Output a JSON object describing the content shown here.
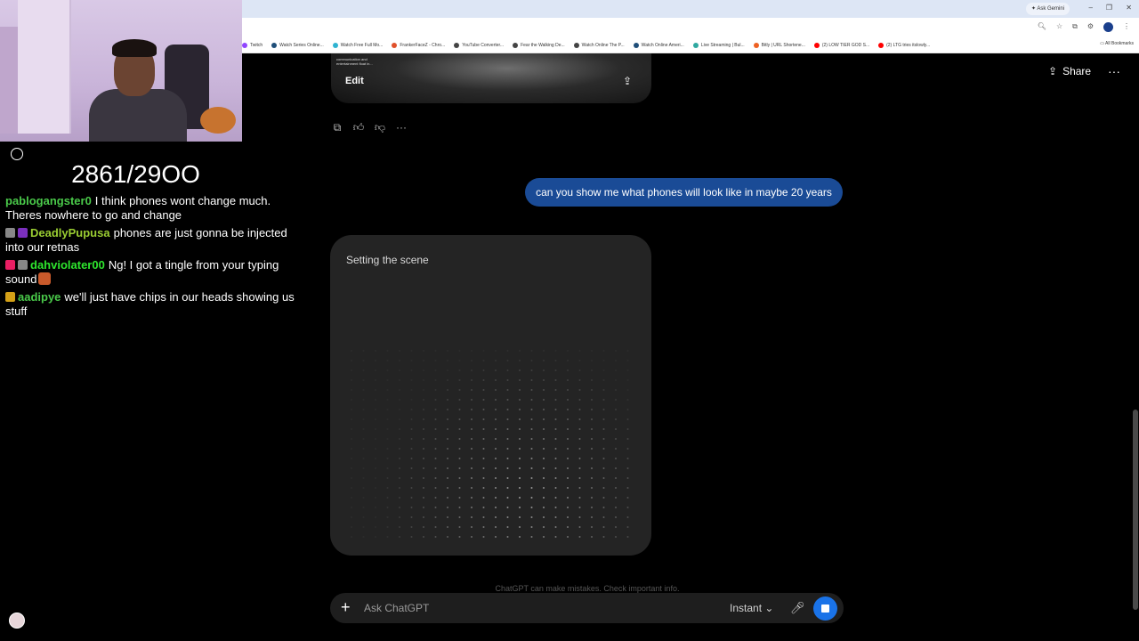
{
  "browser": {
    "ask_gemini": "Ask Gemini",
    "all_bookmarks": "All Bookmarks",
    "bookmarks": [
      {
        "label": "Twitch",
        "color": "#9146ff"
      },
      {
        "label": "Watch Series Online...",
        "color": "#1f4e79"
      },
      {
        "label": "Watch Free Full Mo...",
        "color": "#2fb3d1"
      },
      {
        "label": "FrankerFaceZ - Chro...",
        "color": "#e0512b"
      },
      {
        "label": "YouTube Converter...",
        "color": "#444444"
      },
      {
        "label": "Fear the Walking De...",
        "color": "#444444"
      },
      {
        "label": "Watch Online The P...",
        "color": "#444444"
      },
      {
        "label": "Watch Online Ameri...",
        "color": "#1f4e79"
      },
      {
        "label": "Live Streaming | Bul...",
        "color": "#2fa8a0"
      },
      {
        "label": "Bitly | URL Shortene...",
        "color": "#ee6123"
      },
      {
        "label": "(2) LOW TIER GOD S...",
        "color": "#ff0000"
      },
      {
        "label": "(2) LTG tries itslowly...",
        "color": "#ff0000"
      }
    ]
  },
  "overlay": {
    "counter": "2861/29OO",
    "messages": [
      {
        "user": "pablogangster0",
        "user_color": "#4ac94a",
        "text": "I think phones wont change much. Theres nowhere to go and change",
        "badges": [],
        "emote": false
      },
      {
        "user": "DeadlyPupusa",
        "user_color": "#9acd32",
        "text": "phones are just gonna be injected into our retnas",
        "badges": [
          "#888888",
          "#7b2fbe"
        ],
        "emote": false
      },
      {
        "user": "dahviolater00",
        "user_color": "#2ee62e",
        "text": "Ng! I got a tingle from your typing sound",
        "badges": [
          "#e91e63",
          "#888888"
        ],
        "emote": true
      },
      {
        "user": "aadipye",
        "user_color": "#4ac94a",
        "text": "we'll just have chips in our heads showing us stuff",
        "badges": [
          "#d4a017"
        ],
        "emote": false
      }
    ]
  },
  "chat": {
    "edit_label": "Edit",
    "share_label": "Share",
    "user_message": "can you show me what phones will look like in maybe 20 years",
    "generating_status": "Setting the scene",
    "disclaimer": "ChatGPT can make mistakes. Check important info.",
    "input_placeholder": "Ask ChatGPT",
    "model_label": "Instant",
    "image_caption": "communication and entertainment float in..."
  },
  "colors": {
    "user_bubble": "#1a4b96",
    "stop_button": "#1a73e8",
    "card": "#242424"
  }
}
